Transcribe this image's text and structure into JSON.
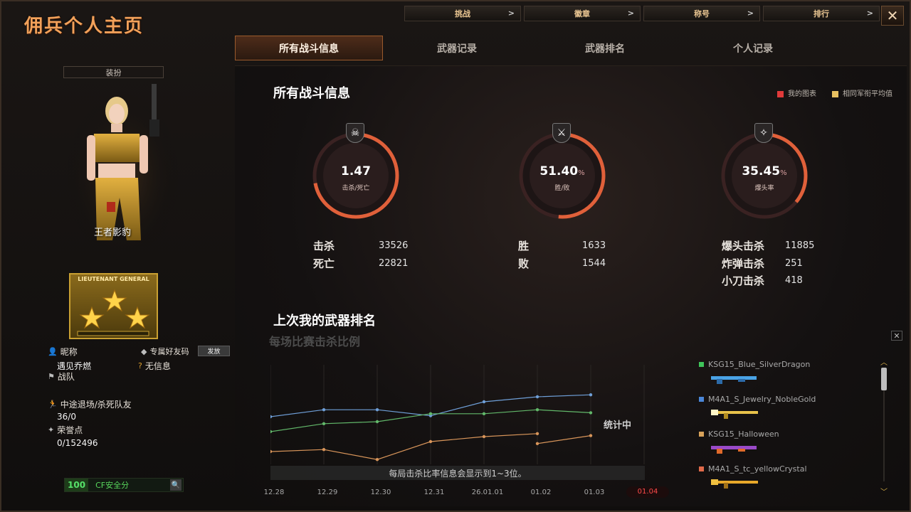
{
  "app": {
    "title": "佣兵个人主页",
    "close_label": "✕"
  },
  "topnav": [
    {
      "label": "挑战",
      "chev": ">"
    },
    {
      "label": "徽章",
      "chev": ">"
    },
    {
      "label": "称号",
      "chev": ">"
    },
    {
      "label": "排行",
      "chev": ">"
    }
  ],
  "tabs": [
    "所有战斗信息",
    "武器记录",
    "武器排名",
    "个人记录"
  ],
  "left": {
    "outfit_label": "装扮",
    "character_name": "王者影豹",
    "rank_text": "LIEUTENANT GENERAL",
    "nickname_label": "昵称",
    "nickname_value": "遇见乔燃",
    "friend_code_label": "专属好友码",
    "send_label": "发放",
    "no_info_label": "无信息",
    "team_label": "战队",
    "quit_label": "中途退场/杀死队友",
    "quit_value": "36/0",
    "honor_label": "荣誉点",
    "honor_value": "0/152496",
    "safety_score": "100",
    "safety_label": "CF安全分"
  },
  "main": {
    "title": "所有战斗信息",
    "legend": [
      {
        "label": "我的图表",
        "color": "#e03a3a"
      },
      {
        "label": "相同军衔平均值",
        "color": "#e8c060"
      }
    ],
    "gauges": [
      {
        "value": "1.47",
        "pct": "",
        "label": "击杀/死亡",
        "icon": "☠",
        "fill": 0.72
      },
      {
        "value": "51.40",
        "pct": "%",
        "label": "胜/败",
        "icon": "⚔",
        "fill": 0.514
      },
      {
        "value": "35.45",
        "pct": "%",
        "label": "爆头率",
        "icon": "✧",
        "fill": 0.36
      }
    ],
    "stats": {
      "kills_label": "击杀",
      "kills_value": "33526",
      "deaths_label": "死亡",
      "deaths_value": "22821",
      "wins_label": "胜",
      "wins_value": "1633",
      "losses_label": "败",
      "losses_value": "1544",
      "headshot_label": "爆头击杀",
      "headshot_value": "11885",
      "bomb_label": "炸弹击杀",
      "bomb_value": "251",
      "knife_label": "小刀击杀",
      "knife_value": "418"
    },
    "weapon_rank_title": "上次我的武器排名",
    "kill_ratio_title": "每场比赛击杀比例",
    "chart_note": "每局击杀比率信息会显示到1~3位。",
    "stat_flag": "统计中",
    "close_label": "✕"
  },
  "chart_data": {
    "type": "line",
    "categories": [
      "12.28",
      "12.29",
      "12.30",
      "12.31",
      "26.01.01",
      "01.02",
      "01.03",
      "01.04"
    ],
    "active_category": "01.04",
    "series": [
      {
        "color": "#6f9fd8",
        "values": [
          0.55,
          0.62,
          0.62,
          0.56,
          0.7,
          0.75,
          0.77,
          null
        ]
      },
      {
        "color": "#62b86a",
        "values": [
          0.4,
          0.48,
          0.5,
          0.58,
          0.58,
          0.62,
          0.59,
          null
        ]
      },
      {
        "color": "#d8955a",
        "values": [
          0.2,
          0.22,
          0.12,
          0.3,
          0.35,
          0.38,
          null,
          null
        ]
      },
      {
        "color": "#d8955a",
        "values": [
          null,
          null,
          null,
          null,
          null,
          0.28,
          0.36,
          null
        ]
      }
    ]
  },
  "weapons": [
    {
      "name": "KSG15_Blue_SilverDragon",
      "color": "#3fc45a",
      "gun": "#4aa3e6"
    },
    {
      "name": "M4A1_S_Jewelry_NobleGold",
      "color": "#4a86d8",
      "gun": "#e8c24a"
    },
    {
      "name": "KSG15_Halloween",
      "color": "#d8a25a",
      "gun": "#9a4ac8"
    },
    {
      "name": "M4A1_S_tc_yellowCrystal",
      "color": "#e06a4a",
      "gun": "#e8a82a"
    }
  ],
  "scroll": {
    "up": "︿",
    "down": "﹀"
  }
}
